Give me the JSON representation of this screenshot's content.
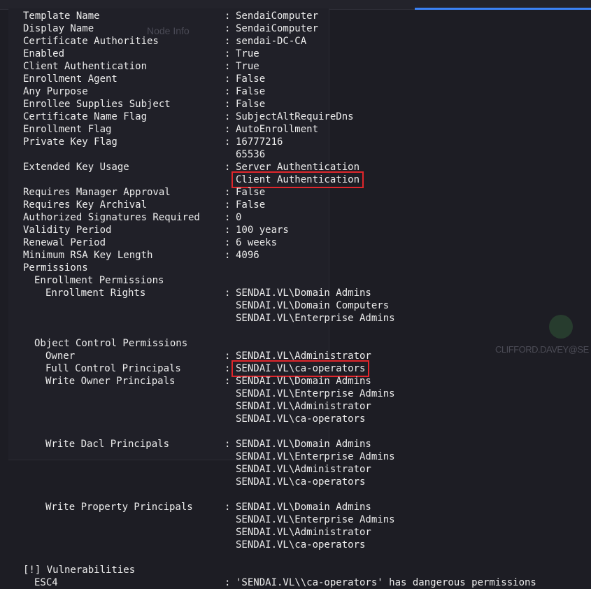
{
  "colors": {
    "highlight": "#e0262b",
    "text": "#ececec",
    "background": "#1d1d24",
    "tab_accent": "#3b82f6"
  },
  "background_window": {
    "tab": "Node Info",
    "avatar_label": "CLIFFORD.DAVEY@SE"
  },
  "template": {
    "fields": [
      {
        "key": "Template Name",
        "value": "SendaiComputer"
      },
      {
        "key": "Display Name",
        "value": "SendaiComputer"
      },
      {
        "key": "Certificate Authorities",
        "value": "sendai-DC-CA"
      },
      {
        "key": "Enabled",
        "value": "True"
      },
      {
        "key": "Client Authentication",
        "value": "True"
      },
      {
        "key": "Enrollment Agent",
        "value": "False"
      },
      {
        "key": "Any Purpose",
        "value": "False"
      },
      {
        "key": "Enrollee Supplies Subject",
        "value": "False"
      },
      {
        "key": "Certificate Name Flag",
        "value": "SubjectAltRequireDns"
      },
      {
        "key": "Enrollment Flag",
        "value": "AutoEnrollment"
      },
      {
        "key": "Private Key Flag",
        "value": "16777216"
      },
      {
        "key": "",
        "value": "65536"
      },
      {
        "key": "Extended Key Usage",
        "value": "Server Authentication"
      },
      {
        "key": "",
        "value": "Client Authentication"
      },
      {
        "key": "Requires Manager Approval",
        "value": "False"
      },
      {
        "key": "Requires Key Archival",
        "value": "False"
      },
      {
        "key": "Authorized Signatures Required",
        "value": "0"
      },
      {
        "key": "Validity Period",
        "value": "100 years"
      },
      {
        "key": "Renewal Period",
        "value": "6 weeks"
      },
      {
        "key": "Minimum RSA Key Length",
        "value": "4096"
      }
    ],
    "permissions_label": "Permissions",
    "enrollment_permissions_label": "Enrollment Permissions",
    "enrollment_rights": {
      "key": "Enrollment Rights",
      "values": [
        "SENDAI.VL\\Domain Admins",
        "SENDAI.VL\\Domain Computers",
        "SENDAI.VL\\Enterprise Admins"
      ]
    },
    "object_control_label": "Object Control Permissions",
    "owner": {
      "key": "Owner",
      "value": "SENDAI.VL\\Administrator"
    },
    "full_control": {
      "key": "Full Control Principals",
      "value": "SENDAI.VL\\ca-operators"
    },
    "write_owner": {
      "key": "Write Owner Principals",
      "values": [
        "SENDAI.VL\\Domain Admins",
        "SENDAI.VL\\Enterprise Admins",
        "SENDAI.VL\\Administrator",
        "SENDAI.VL\\ca-operators"
      ]
    },
    "write_dacl": {
      "key": "Write Dacl Principals",
      "values": [
        "SENDAI.VL\\Domain Admins",
        "SENDAI.VL\\Enterprise Admins",
        "SENDAI.VL\\Administrator",
        "SENDAI.VL\\ca-operators"
      ]
    },
    "write_property": {
      "key": "Write Property Principals",
      "values": [
        "SENDAI.VL\\Domain Admins",
        "SENDAI.VL\\Enterprise Admins",
        "SENDAI.VL\\Administrator",
        "SENDAI.VL\\ca-operators"
      ]
    },
    "vulnerabilities_label": "[!] Vulnerabilities",
    "vulnerability": {
      "key": "ESC4",
      "value": "'SENDAI.VL\\\\ca-operators' has dangerous permissions"
    }
  },
  "separator": ":"
}
